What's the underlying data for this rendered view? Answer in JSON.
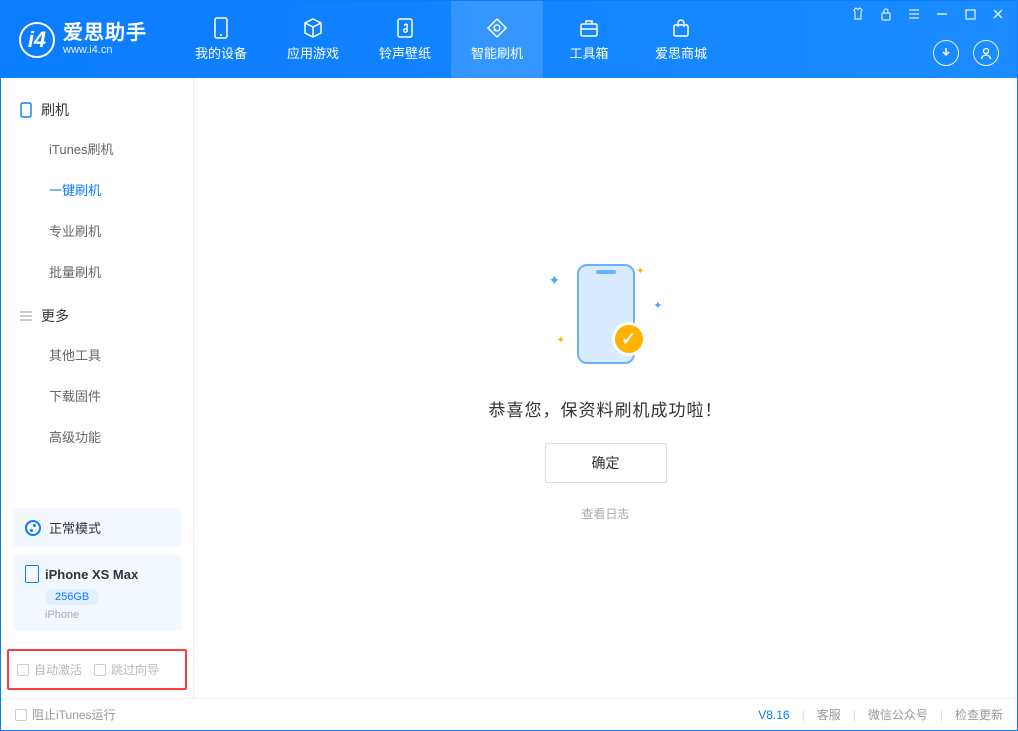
{
  "app": {
    "name": "爱思助手",
    "url": "www.i4.cn"
  },
  "nav": {
    "items": [
      {
        "label": "我的设备",
        "icon": "device"
      },
      {
        "label": "应用游戏",
        "icon": "cube"
      },
      {
        "label": "铃声壁纸",
        "icon": "music"
      },
      {
        "label": "智能刷机",
        "icon": "refresh"
      },
      {
        "label": "工具箱",
        "icon": "toolbox"
      },
      {
        "label": "爱思商城",
        "icon": "store"
      }
    ],
    "active_index": 3
  },
  "sidebar": {
    "groups": [
      {
        "title": "刷机",
        "items": [
          "iTunes刷机",
          "一键刷机",
          "专业刷机",
          "批量刷机"
        ],
        "selected_index": 1
      },
      {
        "title": "更多",
        "items": [
          "其他工具",
          "下载固件",
          "高级功能"
        ],
        "selected_index": -1
      }
    ],
    "mode": {
      "label": "正常模式"
    },
    "device": {
      "name": "iPhone XS Max",
      "badge": "256GB",
      "type": "iPhone"
    },
    "options": {
      "auto_activate": "自动激活",
      "skip_guide": "跳过向导"
    }
  },
  "main": {
    "success_text": "恭喜您，保资料刷机成功啦！",
    "ok_button": "确定",
    "view_log": "查看日志"
  },
  "status": {
    "block_itunes": "阻止iTunes运行",
    "version": "V8.16",
    "links": [
      "客服",
      "微信公众号",
      "检查更新"
    ]
  }
}
